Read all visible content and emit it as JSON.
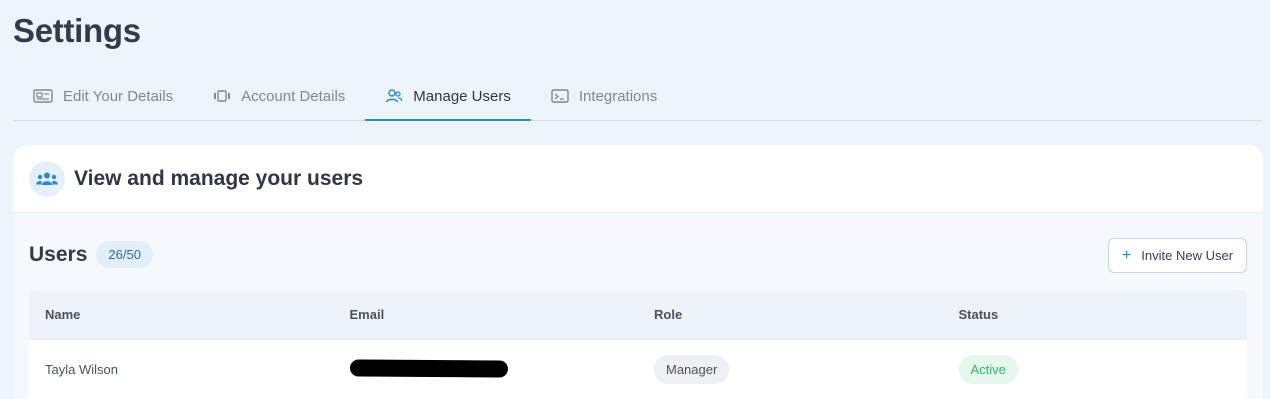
{
  "page": {
    "title": "Settings"
  },
  "tabs": [
    {
      "label": "Edit Your Details",
      "icon": "id-card-icon",
      "active": false
    },
    {
      "label": "Account Details",
      "icon": "account-icon",
      "active": false
    },
    {
      "label": "Manage Users",
      "icon": "users-icon",
      "active": true
    },
    {
      "label": "Integrations",
      "icon": "terminal-icon",
      "active": false
    }
  ],
  "card": {
    "title": "View and manage your users",
    "icon": "user-group-icon"
  },
  "users": {
    "label": "Users",
    "count": "26/50",
    "invite_label": "Invite New User"
  },
  "table": {
    "headers": [
      "Name",
      "Email",
      "Role",
      "Status"
    ],
    "rows": [
      {
        "name": "Tayla Wilson",
        "email": "",
        "email_redacted": true,
        "role": "Manager",
        "status": "Active"
      }
    ]
  },
  "colors": {
    "accent": "#2b8cc9",
    "background": "#edf4fc",
    "status_active": "#31b36a"
  }
}
